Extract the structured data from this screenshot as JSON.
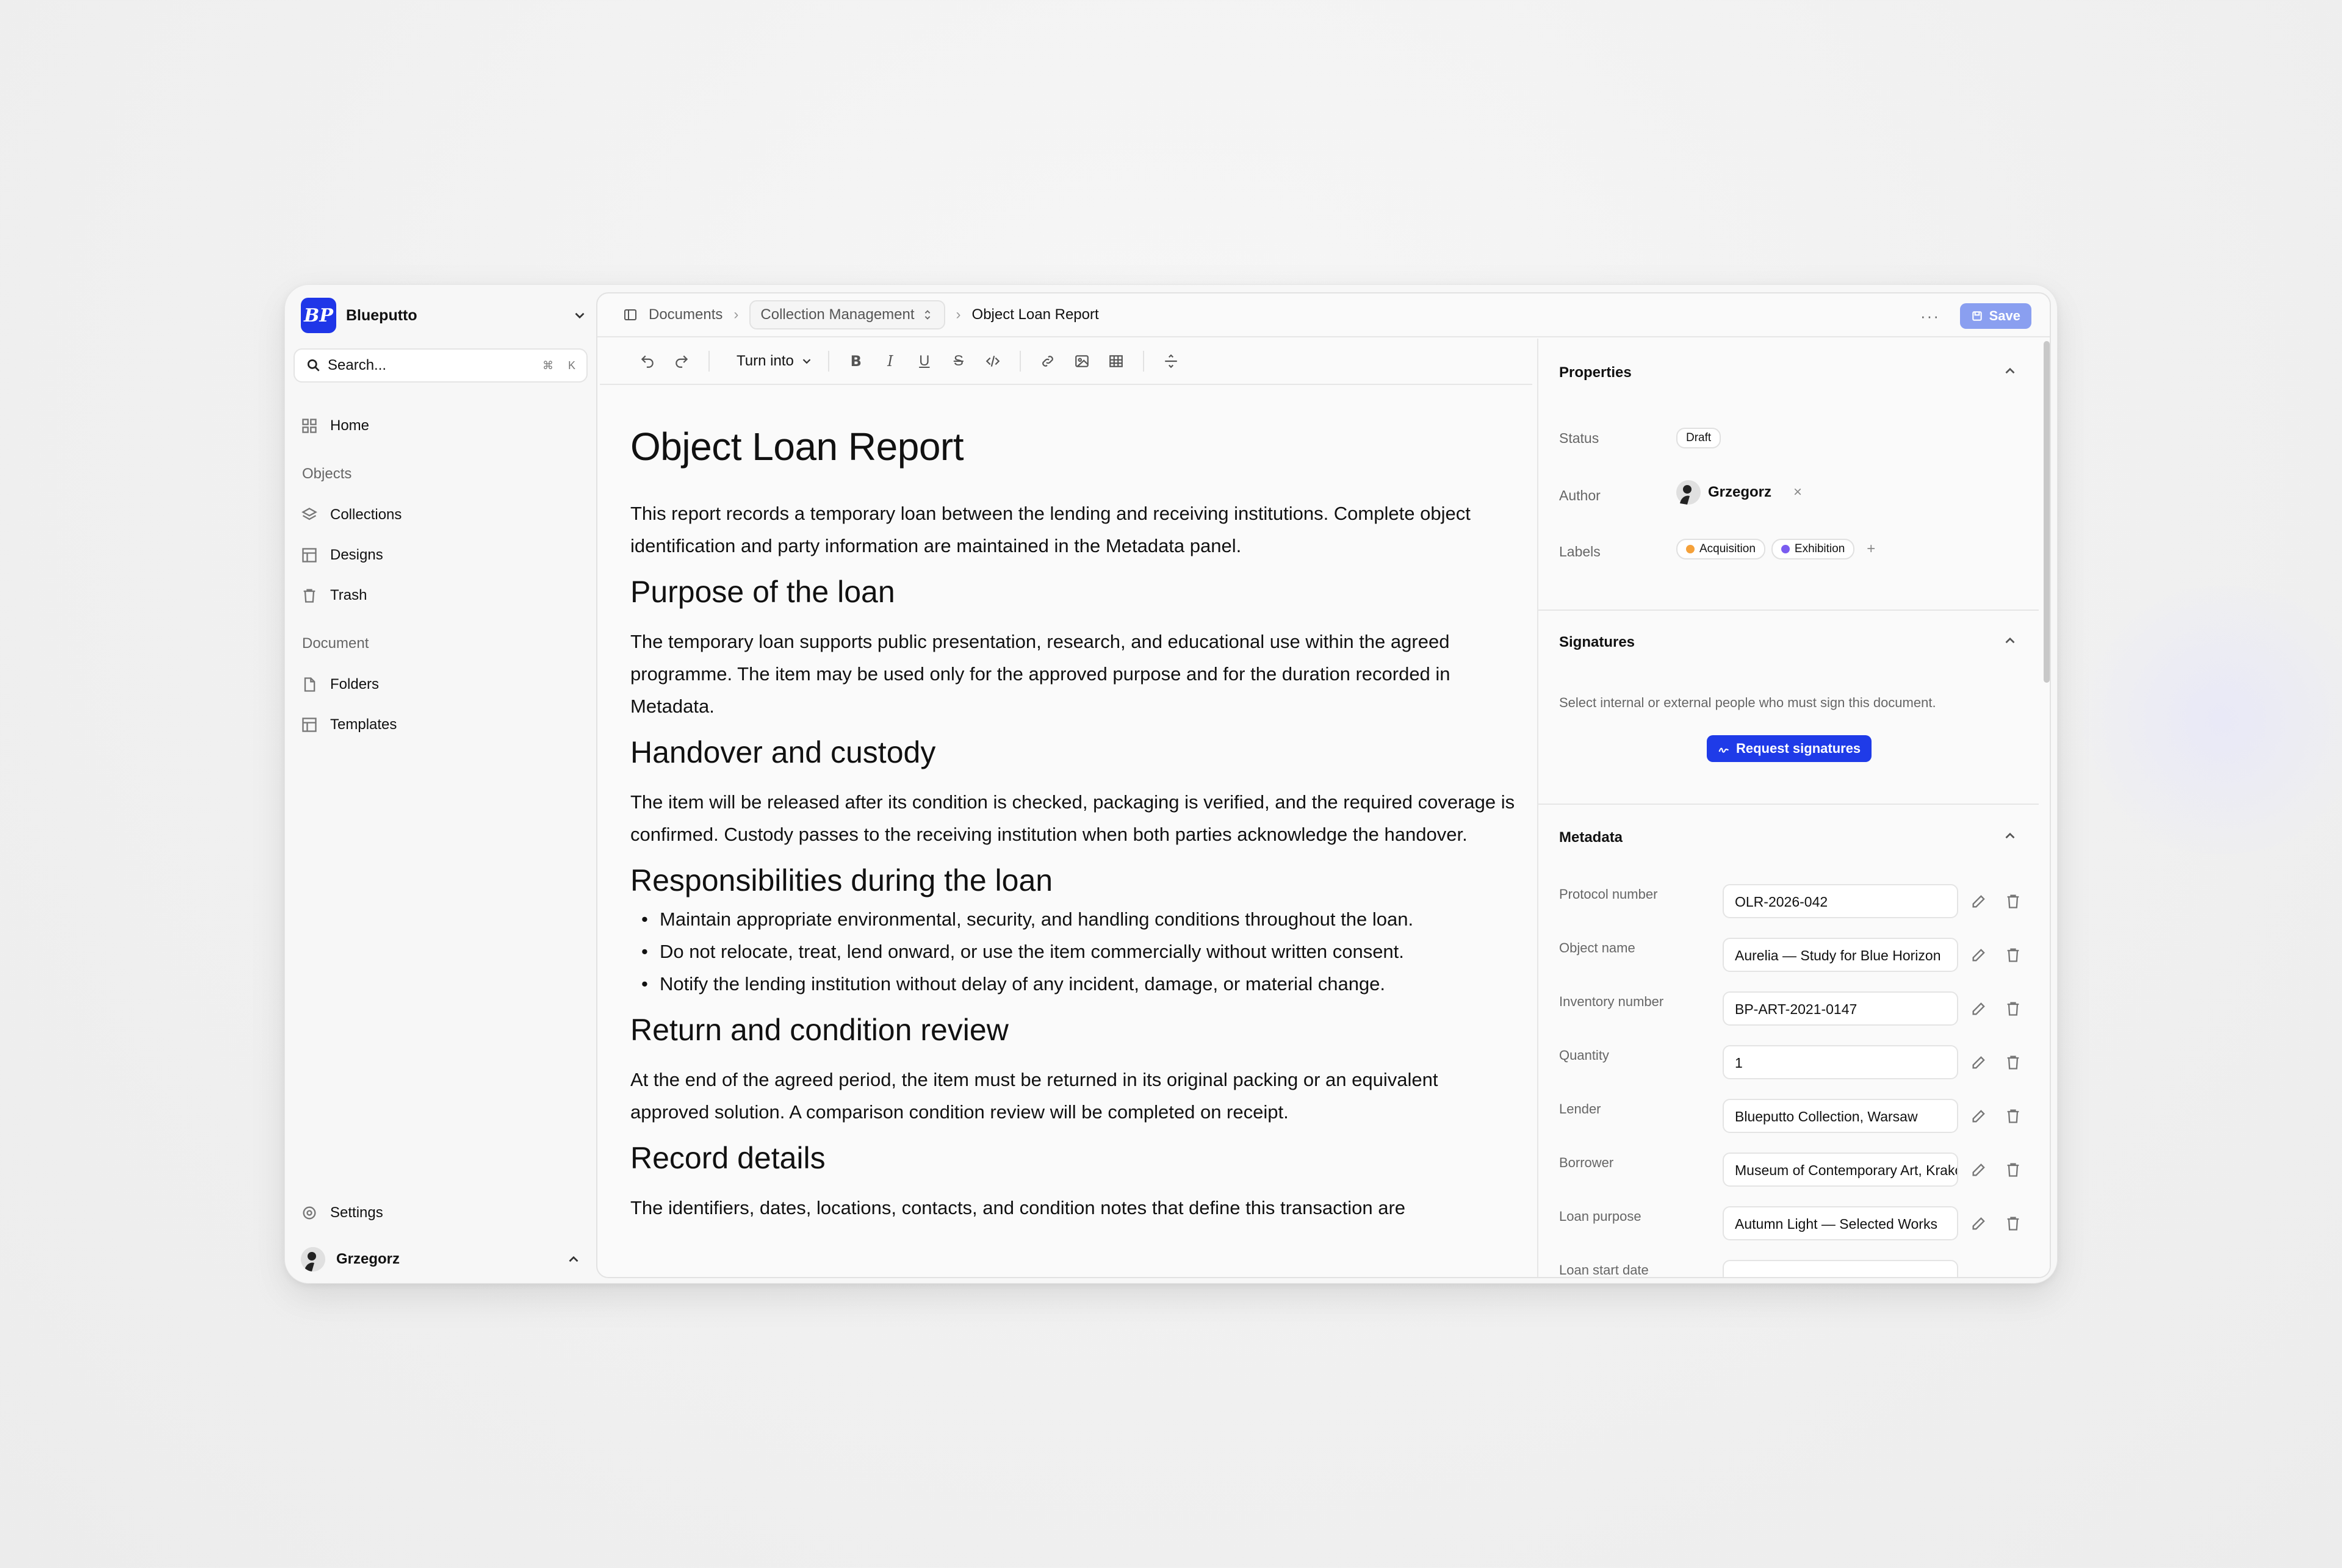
{
  "workspace": {
    "name": "Blueputto",
    "logo_text": "BP"
  },
  "search": {
    "placeholder": "Search...",
    "shortcut_mod": "⌘",
    "shortcut_key": "K"
  },
  "sidebar": {
    "home": "Home",
    "objects_label": "Objects",
    "objects_items": [
      "Collections",
      "Designs",
      "Trash"
    ],
    "document_label": "Document",
    "document_items": [
      "Folders",
      "Templates"
    ],
    "settings": "Settings",
    "user": "Grzegorz"
  },
  "breadcrumb": {
    "root": "Documents",
    "middle": "Collection Management",
    "current": "Object Loan Report"
  },
  "topbar": {
    "more": "···",
    "save_label": "Save"
  },
  "toolbar": {
    "turn_into": "Turn into"
  },
  "doc": {
    "title": "Object Loan Report",
    "intro": "This report records a temporary loan between the lending and receiving institutions. Complete object identification and party information are maintained in the Metadata panel.",
    "h_purpose": "Purpose of the loan",
    "p_purpose": "The temporary loan supports public presentation, research, and educational use within the agreed programme. The item may be used only for the approved purpose and for the duration recorded in Metadata.",
    "h_handover": "Handover and custody",
    "p_handover": "The item will be released after its condition is checked, packaging is verified, and the required coverage is confirmed. Custody passes to the receiving institution when both parties acknowledge the handover.",
    "h_resp": "Responsibilities during the loan",
    "resp_items": [
      "Maintain appropriate environmental, security, and handling conditions throughout the loan.",
      "Do not relocate, treat, lend onward, or use the item commercially without written consent.",
      "Notify the lending institution without delay of any incident, damage, or material change."
    ],
    "h_return": "Return and condition review",
    "p_return": "At the end of the agreed period, the item must be returned in its original packing or an equivalent approved solution. A comparison condition review will be completed on receipt.",
    "h_record": "Record details",
    "p_record": "The identifiers, dates, locations, contacts, and condition notes that define this transaction are"
  },
  "properties": {
    "title": "Properties",
    "status_label": "Status",
    "status_value": "Draft",
    "author_label": "Author",
    "author_value": "Grzegorz",
    "author_remove": "×",
    "labels_label": "Labels",
    "labels": [
      {
        "name": "Acquisition",
        "color": "#f5a13a"
      },
      {
        "name": "Exhibition",
        "color": "#7a5cf0"
      }
    ],
    "labels_add": "+"
  },
  "signatures": {
    "title": "Signatures",
    "description": "Select internal or external people who must sign this document.",
    "button": "Request signatures"
  },
  "metadata": {
    "title": "Metadata",
    "rows": [
      {
        "label": "Protocol number",
        "value": "OLR-2026-042"
      },
      {
        "label": "Object name",
        "value": "Aurelia — Study for Blue Horizon"
      },
      {
        "label": "Inventory number",
        "value": "BP-ART-2021-0147"
      },
      {
        "label": "Quantity",
        "value": "1"
      },
      {
        "label": "Lender",
        "value": "Blueputto Collection, Warsaw"
      },
      {
        "label": "Borrower",
        "value": "Museum of Contemporary Art, Kraków"
      },
      {
        "label": "Loan purpose",
        "value": "Autumn Light — Selected Works"
      },
      {
        "label": "Loan start date",
        "value": ""
      }
    ]
  },
  "colors": {
    "accent": "#1f3be8",
    "save_disabled": "#8a9ff0"
  }
}
